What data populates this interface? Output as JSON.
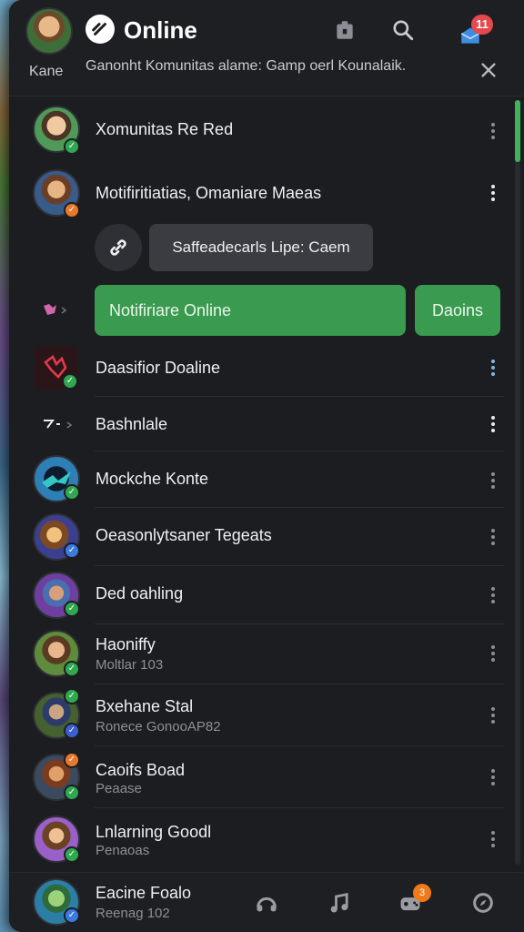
{
  "header": {
    "profile_name": "Kane",
    "title": "Online",
    "subtitle": "Ganonht Komunitas alame: Gamp oerl Kounalaik.",
    "notification_count": "11"
  },
  "rows": [
    {
      "title": "Xomunitas Re Red",
      "subtitle": ""
    },
    {
      "title": "Motifiritiatias, Omaniare Maeas",
      "subtitle": ""
    },
    {
      "title": "Daasifior Doaline",
      "subtitle": ""
    },
    {
      "title": "Bashnlale",
      "subtitle": ""
    },
    {
      "title": "Mockche Konte",
      "subtitle": ""
    },
    {
      "title": "Oeasonlytsaner Tegeats",
      "subtitle": ""
    },
    {
      "title": "Ded oahling",
      "subtitle": ""
    },
    {
      "title": "Haoniffy",
      "subtitle": "Moltlar 103"
    },
    {
      "title": "Bxehane Stal",
      "subtitle": "Ronece GonooAP82"
    },
    {
      "title": "Caoifs Boad",
      "subtitle": "Peaase"
    },
    {
      "title": "Lnlarning Goodl",
      "subtitle": "Penaoas"
    }
  ],
  "link_chip": "Saffeadecarls Lipe: Caem",
  "actions": {
    "primary": "Notifiriare Online",
    "secondary": "Daoins"
  },
  "bottom": {
    "title": "Eacine Foalo",
    "subtitle": "Reenag 102",
    "badge": "3"
  },
  "colors": {
    "accent_green": "#3a9a4f",
    "online_dot": "#2fa84f",
    "panel_bg": "#1c1d20",
    "badge_red": "#e5484d",
    "badge_orange": "#f07a1a"
  },
  "icons": [
    "app-logo-icon",
    "calendar-icon",
    "search-icon",
    "inbox-icon",
    "close-icon",
    "link-icon",
    "tag-icon",
    "more-vertical-icon",
    "headset-icon",
    "music-icon",
    "gamepad-icon",
    "discover-icon"
  ]
}
